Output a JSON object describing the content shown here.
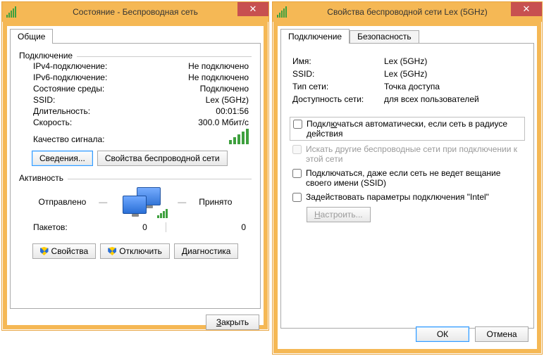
{
  "win1": {
    "title": "Состояние - Беспроводная сеть",
    "tab_general": "Общие",
    "group_connection": "Подключение",
    "rows": {
      "ipv4_k": "IPv4-подключение:",
      "ipv4_v": "Не подключено",
      "ipv6_k": "IPv6-подключение:",
      "ipv6_v": "Не подключено",
      "media_k": "Состояние среды:",
      "media_v": "Подключено",
      "ssid_k": "SSID:",
      "ssid_v": "Lex (5GHz)",
      "dur_k": "Длительность:",
      "dur_v": "00:01:56",
      "speed_k": "Скорость:",
      "speed_v": "300.0 Мбит/с",
      "signal_k": "Качество сигнала:"
    },
    "btn_details": "Сведения...",
    "btn_wprops": "Свойства беспроводной сети",
    "group_activity": "Активность",
    "sent_label": "Отправлено",
    "recv_label": "Принято",
    "packets_k": "Пакетов:",
    "packets_sent": "0",
    "packets_recv": "0",
    "btn_props": "Свойства",
    "btn_disable": "Отключить",
    "btn_diag": "Диагностика",
    "btn_close": "Закрыть"
  },
  "win2": {
    "title": "Свойства беспроводной сети Lex (5GHz)",
    "tab_conn": "Подключение",
    "tab_sec": "Безопасность",
    "rows": {
      "name_k": "Имя:",
      "name_v": "Lex (5GHz)",
      "ssid_k": "SSID:",
      "ssid_v": "Lex (5GHz)",
      "ntype_k": "Тип сети:",
      "ntype_v": "Точка доступа",
      "avail_k": "Доступность сети:",
      "avail_v": "для всех пользователей"
    },
    "chk_auto": "Подключаться автоматически, если сеть в радиусе действия",
    "chk_other": "Искать другие беспроводные сети при подключении к этой сети",
    "chk_hidden": "Подключаться, даже если сеть не ведет вещание своего имени (SSID)",
    "chk_intel": "Задействовать параметры подключения \"Intel\"",
    "btn_config": "Настроить...",
    "btn_ok": "ОК",
    "btn_cancel": "Отмена"
  }
}
